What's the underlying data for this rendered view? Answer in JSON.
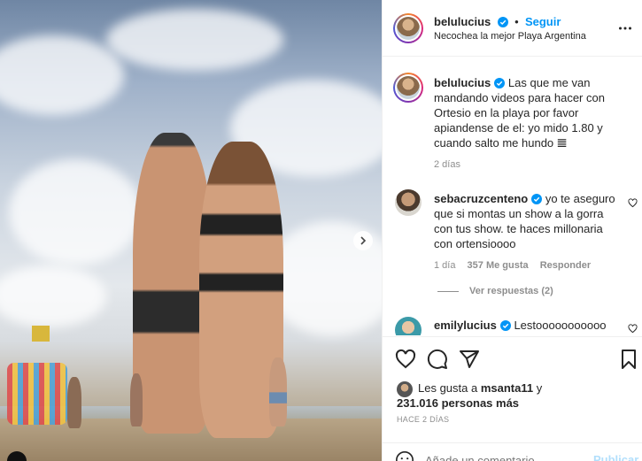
{
  "post": {
    "author": "belulucius",
    "follow_label": "Seguir",
    "location": "Necochea la mejor Playa Argentina",
    "more_icon": "more-horizontal-icon",
    "verified_icon": "verified-badge-icon"
  },
  "caption": {
    "author": "belulucius",
    "text": "Las que me van mandando videos para hacer con Ortesio en la playa por favor apiandense de el: yo mido 1.80 y cuando salto me hundo 𝌆",
    "age": "2 días"
  },
  "comments": [
    {
      "author": "sebacruzcenteno",
      "text": "yo te aseguro que si montas un show a la gorra con tus show. te haces millonaria con ortensioooo",
      "age": "1 día",
      "likes": "357 Me gusta",
      "reply_label": "Responder",
      "view_replies": "Ver respuestas (2)"
    },
    {
      "author": "emilylucius",
      "text": "Lestooooooooooo"
    }
  ],
  "likes": {
    "prefix": "Les gusta a ",
    "user": "msanta11",
    "suffix": " y",
    "others": "231.016 personas más"
  },
  "timestamp": "HACE 2 DÍAS",
  "add_comment": {
    "placeholder": "Añade un comentario...",
    "post_label": "Publicar"
  },
  "colors": {
    "accent": "#0095f6",
    "text": "#262626",
    "muted": "#8e8e8e"
  }
}
